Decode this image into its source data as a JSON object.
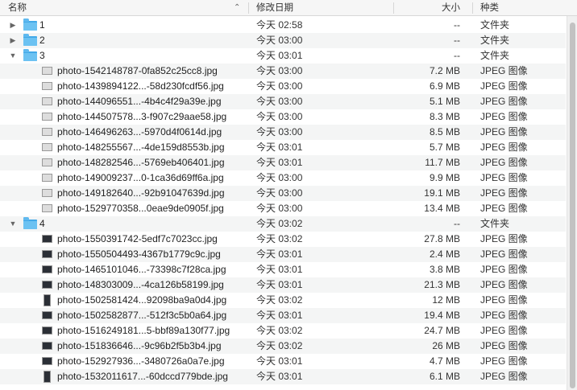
{
  "header": {
    "name_label": "名称",
    "sort_indicator": "⌃",
    "date_label": "修改日期",
    "size_label": "大小",
    "kind_label": "种类"
  },
  "rows": [
    {
      "type": "folder",
      "disclosure": "▶",
      "name": "1",
      "date": "今天 02:58",
      "size": "--",
      "kind": "文件夹"
    },
    {
      "type": "folder",
      "disclosure": "▶",
      "name": "2",
      "date": "今天 03:00",
      "size": "--",
      "kind": "文件夹"
    },
    {
      "type": "folder",
      "disclosure": "▼",
      "name": "3",
      "date": "今天 03:01",
      "size": "--",
      "kind": "文件夹"
    },
    {
      "type": "file",
      "thumb": "light",
      "name": "photo-1542148787-0fa852c25cc8.jpg",
      "date": "今天 03:00",
      "size": "7.2 MB",
      "kind": "JPEG 图像"
    },
    {
      "type": "file",
      "thumb": "light",
      "name": "photo-1439894122...-58d230fcdf56.jpg",
      "date": "今天 03:00",
      "size": "6.9 MB",
      "kind": "JPEG 图像"
    },
    {
      "type": "file",
      "thumb": "light",
      "name": "photo-144096551...-4b4c4f29a39e.jpg",
      "date": "今天 03:00",
      "size": "5.1 MB",
      "kind": "JPEG 图像"
    },
    {
      "type": "file",
      "thumb": "light",
      "name": "photo-144507578...3-f907c29aae58.jpg",
      "date": "今天 03:00",
      "size": "8.3 MB",
      "kind": "JPEG 图像"
    },
    {
      "type": "file",
      "thumb": "light",
      "name": "photo-146496263...-5970d4f0614d.jpg",
      "date": "今天 03:00",
      "size": "8.5 MB",
      "kind": "JPEG 图像"
    },
    {
      "type": "file",
      "thumb": "light",
      "name": "photo-148255567...-4de159d8553b.jpg",
      "date": "今天 03:01",
      "size": "5.7 MB",
      "kind": "JPEG 图像"
    },
    {
      "type": "file",
      "thumb": "light",
      "name": "photo-148282546...-5769eb406401.jpg",
      "date": "今天 03:01",
      "size": "11.7 MB",
      "kind": "JPEG 图像"
    },
    {
      "type": "file",
      "thumb": "light",
      "name": "photo-149009237...0-1ca36d69ff6a.jpg",
      "date": "今天 03:00",
      "size": "9.9 MB",
      "kind": "JPEG 图像"
    },
    {
      "type": "file",
      "thumb": "light",
      "name": "photo-149182640...-92b91047639d.jpg",
      "date": "今天 03:00",
      "size": "19.1 MB",
      "kind": "JPEG 图像"
    },
    {
      "type": "file",
      "thumb": "light",
      "name": "photo-1529770358...0eae9de0905f.jpg",
      "date": "今天 03:00",
      "size": "13.4 MB",
      "kind": "JPEG 图像"
    },
    {
      "type": "folder",
      "disclosure": "▼",
      "name": "4",
      "date": "今天 03:02",
      "size": "--",
      "kind": "文件夹"
    },
    {
      "type": "file",
      "thumb": "dark",
      "name": "photo-1550391742-5edf7c7023cc.jpg",
      "date": "今天 03:02",
      "size": "27.8 MB",
      "kind": "JPEG 图像"
    },
    {
      "type": "file",
      "thumb": "dark",
      "name": "photo-1550504493-4367b1779c9c.jpg",
      "date": "今天 03:01",
      "size": "2.4 MB",
      "kind": "JPEG 图像"
    },
    {
      "type": "file",
      "thumb": "dark",
      "name": "photo-1465101046...-73398c7f28ca.jpg",
      "date": "今天 03:01",
      "size": "3.8 MB",
      "kind": "JPEG 图像"
    },
    {
      "type": "file",
      "thumb": "dark",
      "name": "photo-148303009...-4ca126b58199.jpg",
      "date": "今天 03:01",
      "size": "21.3 MB",
      "kind": "JPEG 图像"
    },
    {
      "type": "file",
      "thumb": "tall",
      "name": "photo-1502581424...92098ba9a0d4.jpg",
      "date": "今天 03:02",
      "size": "12 MB",
      "kind": "JPEG 图像"
    },
    {
      "type": "file",
      "thumb": "dark",
      "name": "photo-1502582877...-512f3c5b0a64.jpg",
      "date": "今天 03:01",
      "size": "19.4 MB",
      "kind": "JPEG 图像"
    },
    {
      "type": "file",
      "thumb": "dark",
      "name": "photo-1516249181...5-bbf89a130f77.jpg",
      "date": "今天 03:02",
      "size": "24.7 MB",
      "kind": "JPEG 图像"
    },
    {
      "type": "file",
      "thumb": "dark",
      "name": "photo-151836646...-9c96b2f5b3b4.jpg",
      "date": "今天 03:02",
      "size": "26 MB",
      "kind": "JPEG 图像"
    },
    {
      "type": "file",
      "thumb": "dark",
      "name": "photo-152927936...-3480726a0a7e.jpg",
      "date": "今天 03:01",
      "size": "4.7 MB",
      "kind": "JPEG 图像"
    },
    {
      "type": "file",
      "thumb": "tall",
      "name": "photo-1532011617...-60dccd779bde.jpg",
      "date": "今天 03:01",
      "size": "6.1 MB",
      "kind": "JPEG 图像"
    }
  ]
}
